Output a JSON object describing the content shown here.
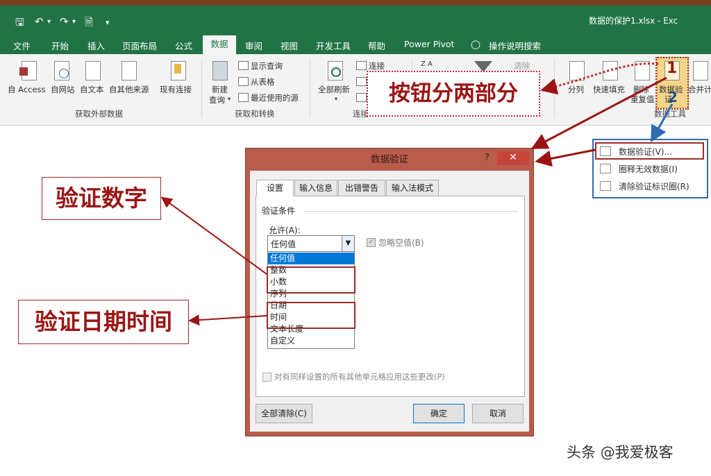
{
  "window": {
    "title": "数据的保护1.xlsx  -  Exc",
    "qat_icons": [
      "save-icon",
      "undo-icon",
      "redo-icon",
      "touch-mode-icon",
      "customize-icon"
    ]
  },
  "menu_tabs": [
    "文件",
    "开始",
    "插入",
    "页面布局",
    "公式",
    "数据",
    "审阅",
    "视图",
    "开发工具",
    "帮助",
    "Power Pivot",
    "操作说明搜索"
  ],
  "active_tab": "数据",
  "ribbon": {
    "get_external": {
      "group": "获取外部数据",
      "buttons": [
        "自 Access",
        "自网站",
        "自文本",
        "自其他来源",
        "现有连接"
      ]
    },
    "get_transform": {
      "group": "获取和转换",
      "new_query": [
        "新建",
        "查询"
      ],
      "small": [
        "显示查询",
        "从表格",
        "最近使用的源"
      ]
    },
    "connections": {
      "group": "连接",
      "refresh_all": "全部刷新",
      "small": "连接"
    },
    "sort_filter": {
      "za": "Z A",
      "clear": "清除"
    },
    "data_tools": {
      "group": "数据工具",
      "buttons": [
        "分列",
        "快速填充",
        "删除",
        "重复值",
        "数据验",
        "证",
        "合并计"
      ]
    }
  },
  "dialog": {
    "title": "数据验证",
    "help": "?",
    "close": "✕",
    "tabs": [
      "设置",
      "输入信息",
      "出错警告",
      "输入法模式"
    ],
    "section": "验证条件",
    "allow_label": "允许(A):",
    "allow_value": "任何值",
    "ignore_blank": "忽略空值(B)",
    "options": [
      "任何值",
      "整数",
      "小数",
      "序列",
      "日期",
      "时间",
      "文本长度",
      "自定义"
    ],
    "apply_all": "对有同样设置的所有其他单元格应用这些更改(P)",
    "clear_all": "全部清除(C)",
    "ok": "确定",
    "cancel": "取消"
  },
  "popup_menu": [
    "数据验证(V)...",
    "圈释无效数据(I)",
    "清除验证标识圈(R)"
  ],
  "annotations": {
    "split_button": "按钮分两部分",
    "verify_number": "验证数字",
    "verify_datetime": "验证日期时间",
    "num1": "1",
    "num2": "2"
  },
  "watermark": "头条 @我爱极客",
  "colors": {
    "excel_green": "#217346",
    "dialog_border": "#b85c4b",
    "annotation_red": "#9b2a2a",
    "popup_blue": "#2e6cae"
  }
}
